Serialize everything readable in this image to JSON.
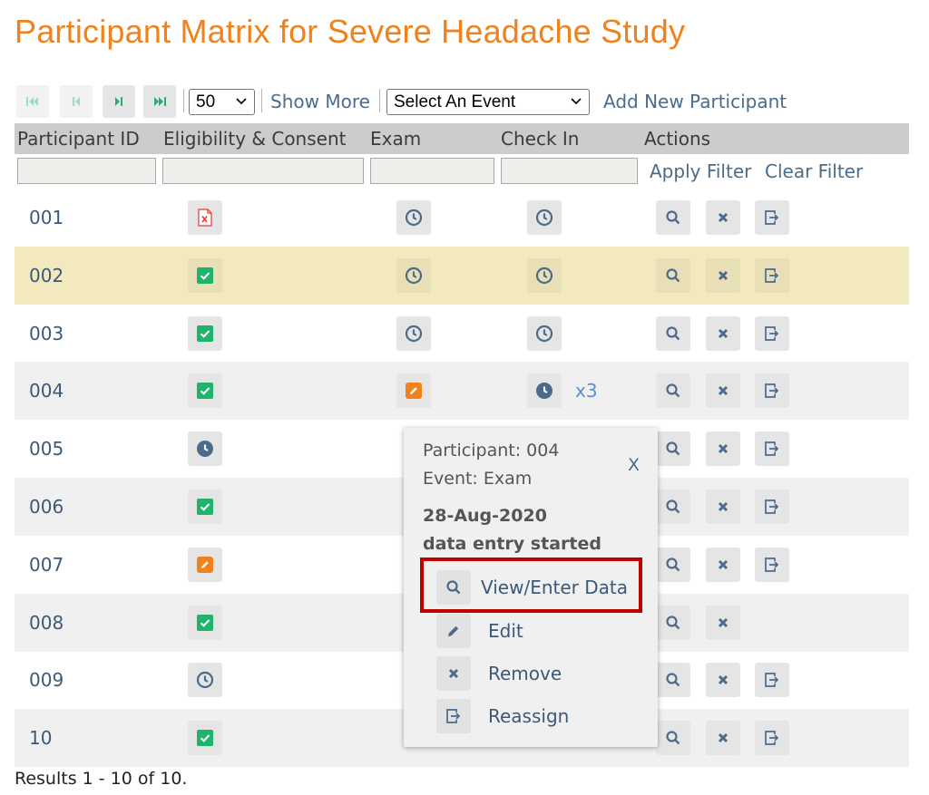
{
  "title": "Participant Matrix for Severe Headache Study",
  "toolbar": {
    "page_size": "50",
    "show_more": "Show More",
    "event_select": "Select An Event",
    "add_new": "Add New Participant"
  },
  "table": {
    "headers": {
      "participant_id": "Participant ID",
      "eligibility": "Eligibility & Consent",
      "exam": "Exam",
      "check_in": "Check In",
      "actions": "Actions"
    },
    "apply_filter": "Apply Filter",
    "clear_filter": "Clear Filter",
    "rows": [
      {
        "id": "001",
        "eligibility": "invalid",
        "exam": "scheduled",
        "check_in": "scheduled",
        "actions": [
          "view",
          "remove",
          "reassign"
        ]
      },
      {
        "id": "002",
        "eligibility": "completed",
        "exam": "scheduled",
        "check_in": "scheduled",
        "actions": [
          "view",
          "remove",
          "reassign"
        ]
      },
      {
        "id": "003",
        "eligibility": "completed",
        "exam": "scheduled",
        "check_in": "scheduled",
        "actions": [
          "view",
          "remove",
          "reassign"
        ]
      },
      {
        "id": "004",
        "eligibility": "completed",
        "exam": "data-entry-started",
        "check_in": "scheduled-repeat",
        "check_in_repeat": "x3",
        "actions": [
          "view",
          "remove",
          "reassign"
        ]
      },
      {
        "id": "005",
        "eligibility": "scheduled-dark",
        "actions": [
          "view",
          "remove",
          "reassign"
        ]
      },
      {
        "id": "006",
        "eligibility": "completed",
        "actions": [
          "view",
          "remove",
          "reassign"
        ]
      },
      {
        "id": "007",
        "eligibility": "data-entry-started",
        "actions": [
          "view",
          "remove",
          "reassign"
        ]
      },
      {
        "id": "008",
        "eligibility": "completed",
        "actions": [
          "view",
          "remove"
        ]
      },
      {
        "id": "009",
        "eligibility": "scheduled",
        "actions": [
          "view",
          "remove",
          "reassign"
        ]
      },
      {
        "id": "10",
        "eligibility": "completed",
        "actions": [
          "view",
          "remove",
          "reassign"
        ]
      }
    ],
    "results": "Results 1 - 10 of 10."
  },
  "popup": {
    "participant": "Participant: 004",
    "event": "Event: Exam",
    "date": "28-Aug-2020",
    "status": "data entry started",
    "close": "X",
    "menu": [
      {
        "label": "View/Enter Data",
        "icon": "search-icon"
      },
      {
        "label": "Edit",
        "icon": "pencil-icon"
      },
      {
        "label": "Remove",
        "icon": "close-icon"
      },
      {
        "label": "Reassign",
        "icon": "reassign-icon"
      }
    ]
  },
  "colors": {
    "title": "#f0821e",
    "link": "#4a6b8a",
    "completed": "#1fb36b",
    "scheduled": "#4a6b8a",
    "data_entry_started": "#f0821e",
    "invalid": "#e53935",
    "selected_row": "#f3e9be",
    "highlight": "#c00000"
  }
}
